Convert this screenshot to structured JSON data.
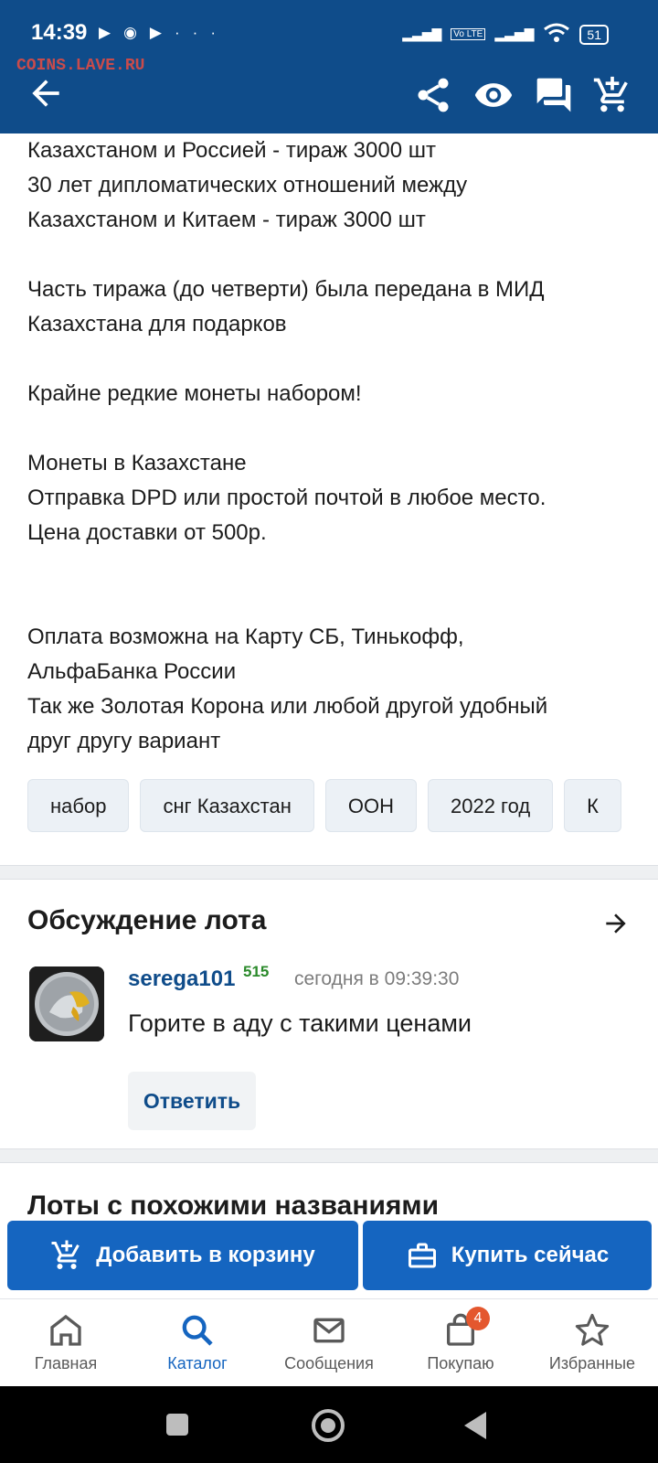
{
  "status_bar": {
    "time": "14:39",
    "battery": "51",
    "left_icons": [
      "play-icon",
      "chrome-icon",
      "play-icon",
      "more-icon"
    ],
    "right_icons": [
      "signal-icon",
      "volte-icon",
      "signal-icon",
      "wifi-icon",
      "battery-icon"
    ]
  },
  "app_bar": {
    "watermark": "COINS.LAVE.RU",
    "icons": [
      "back-arrow-icon",
      "share-icon",
      "eye-icon",
      "forum-icon",
      "add-cart-icon"
    ],
    "color": "#0f4c8a"
  },
  "content": {
    "lines": [
      "Казахстаном и Россией - тираж 3000 шт",
      "30 лет дипломатических отношений между",
      "Казахстаном и Китаем - тираж 3000 шт",
      "",
      "Часть тиража (до четверти) была передана в МИД",
      "Казахстана для подарков",
      "",
      "Крайне редкие монеты набором!",
      "",
      "Монеты в Казахстане",
      "Отправка DPD или простой почтой в любое место.",
      "Цена доставки от 500р.",
      "",
      "",
      "Оплата возможна на Карту СБ, Тинькофф,",
      "АльфаБанка России",
      "Так же Золотая Корона или любой другой удобный",
      "друг другу вариант"
    ]
  },
  "tags": [
    "набор",
    "снг Казахстан",
    "ООН",
    "2022 год",
    "К"
  ],
  "discussion": {
    "title": "Обсуждение лота",
    "comment": {
      "username": "serega101",
      "rating": "515",
      "timestamp": "сегодня в 09:39:30",
      "text": "Горите в аду с такими ценами",
      "reply_label": "Ответить"
    }
  },
  "similar": {
    "title": "Лоты с похожими названиями"
  },
  "actions": {
    "add_to_cart": "Добавить в корзину",
    "buy_now": "Купить сейчас",
    "color": "#1565c0"
  },
  "bottom_nav": {
    "items": [
      {
        "label": "Главная",
        "icon": "home-icon"
      },
      {
        "label": "Каталог",
        "icon": "search-icon"
      },
      {
        "label": "Сообщения",
        "icon": "mail-icon"
      },
      {
        "label": "Покупаю",
        "icon": "bag-icon",
        "badge": "4"
      },
      {
        "label": "Избранные",
        "icon": "star-icon"
      }
    ],
    "active": "Каталог"
  }
}
